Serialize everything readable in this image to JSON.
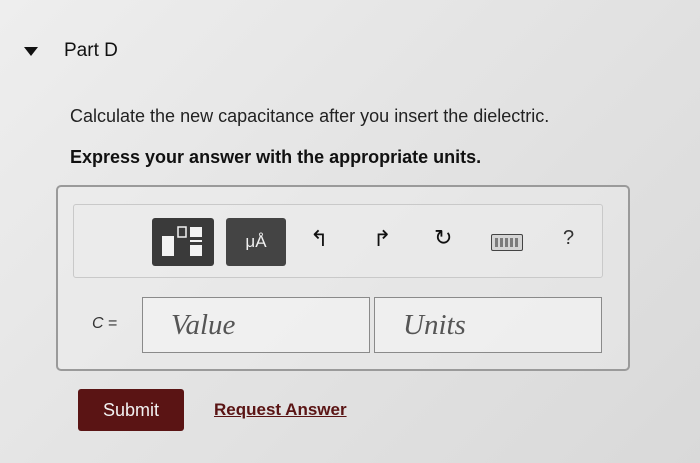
{
  "part": {
    "title": "Part D"
  },
  "question": {
    "text": "Calculate the new capacitance after you insert the dielectric.",
    "instruction": "Express your answer with the appropriate units."
  },
  "toolbar": {
    "units_label": "μÅ",
    "undo_glyph": "↰",
    "redo_glyph": "↱",
    "reset_glyph": "↻",
    "help_glyph": "?"
  },
  "answer": {
    "variable": "C",
    "equals": "=",
    "value_placeholder": "Value",
    "units_placeholder": "Units"
  },
  "actions": {
    "submit_label": "Submit",
    "request_answer_label": "Request Answer"
  },
  "colors": {
    "submit_bg": "#5a1414",
    "toolbar_btn_bg": "#3a3a3a"
  }
}
